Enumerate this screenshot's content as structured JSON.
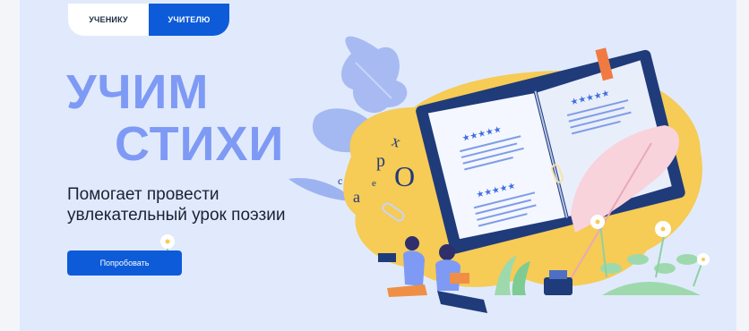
{
  "tabs": [
    {
      "label": "УЧЕНИКУ",
      "active": false
    },
    {
      "label": "УЧИТЕЛЮ",
      "active": true
    }
  ],
  "hero": {
    "title_line1": "УЧИМ",
    "title_line2": "СТИХИ",
    "subtitle_line1": "Помогает провести",
    "subtitle_line2": "увлекательный урок поэзии",
    "cta_label": "Попробовать"
  },
  "letters": [
    "х",
    "р",
    "О",
    "с",
    "е",
    "а"
  ],
  "colors": {
    "accent": "#0d5bd9",
    "title": "#7e9af5",
    "background": "#e1eafc",
    "blob": "#f6cb56"
  }
}
